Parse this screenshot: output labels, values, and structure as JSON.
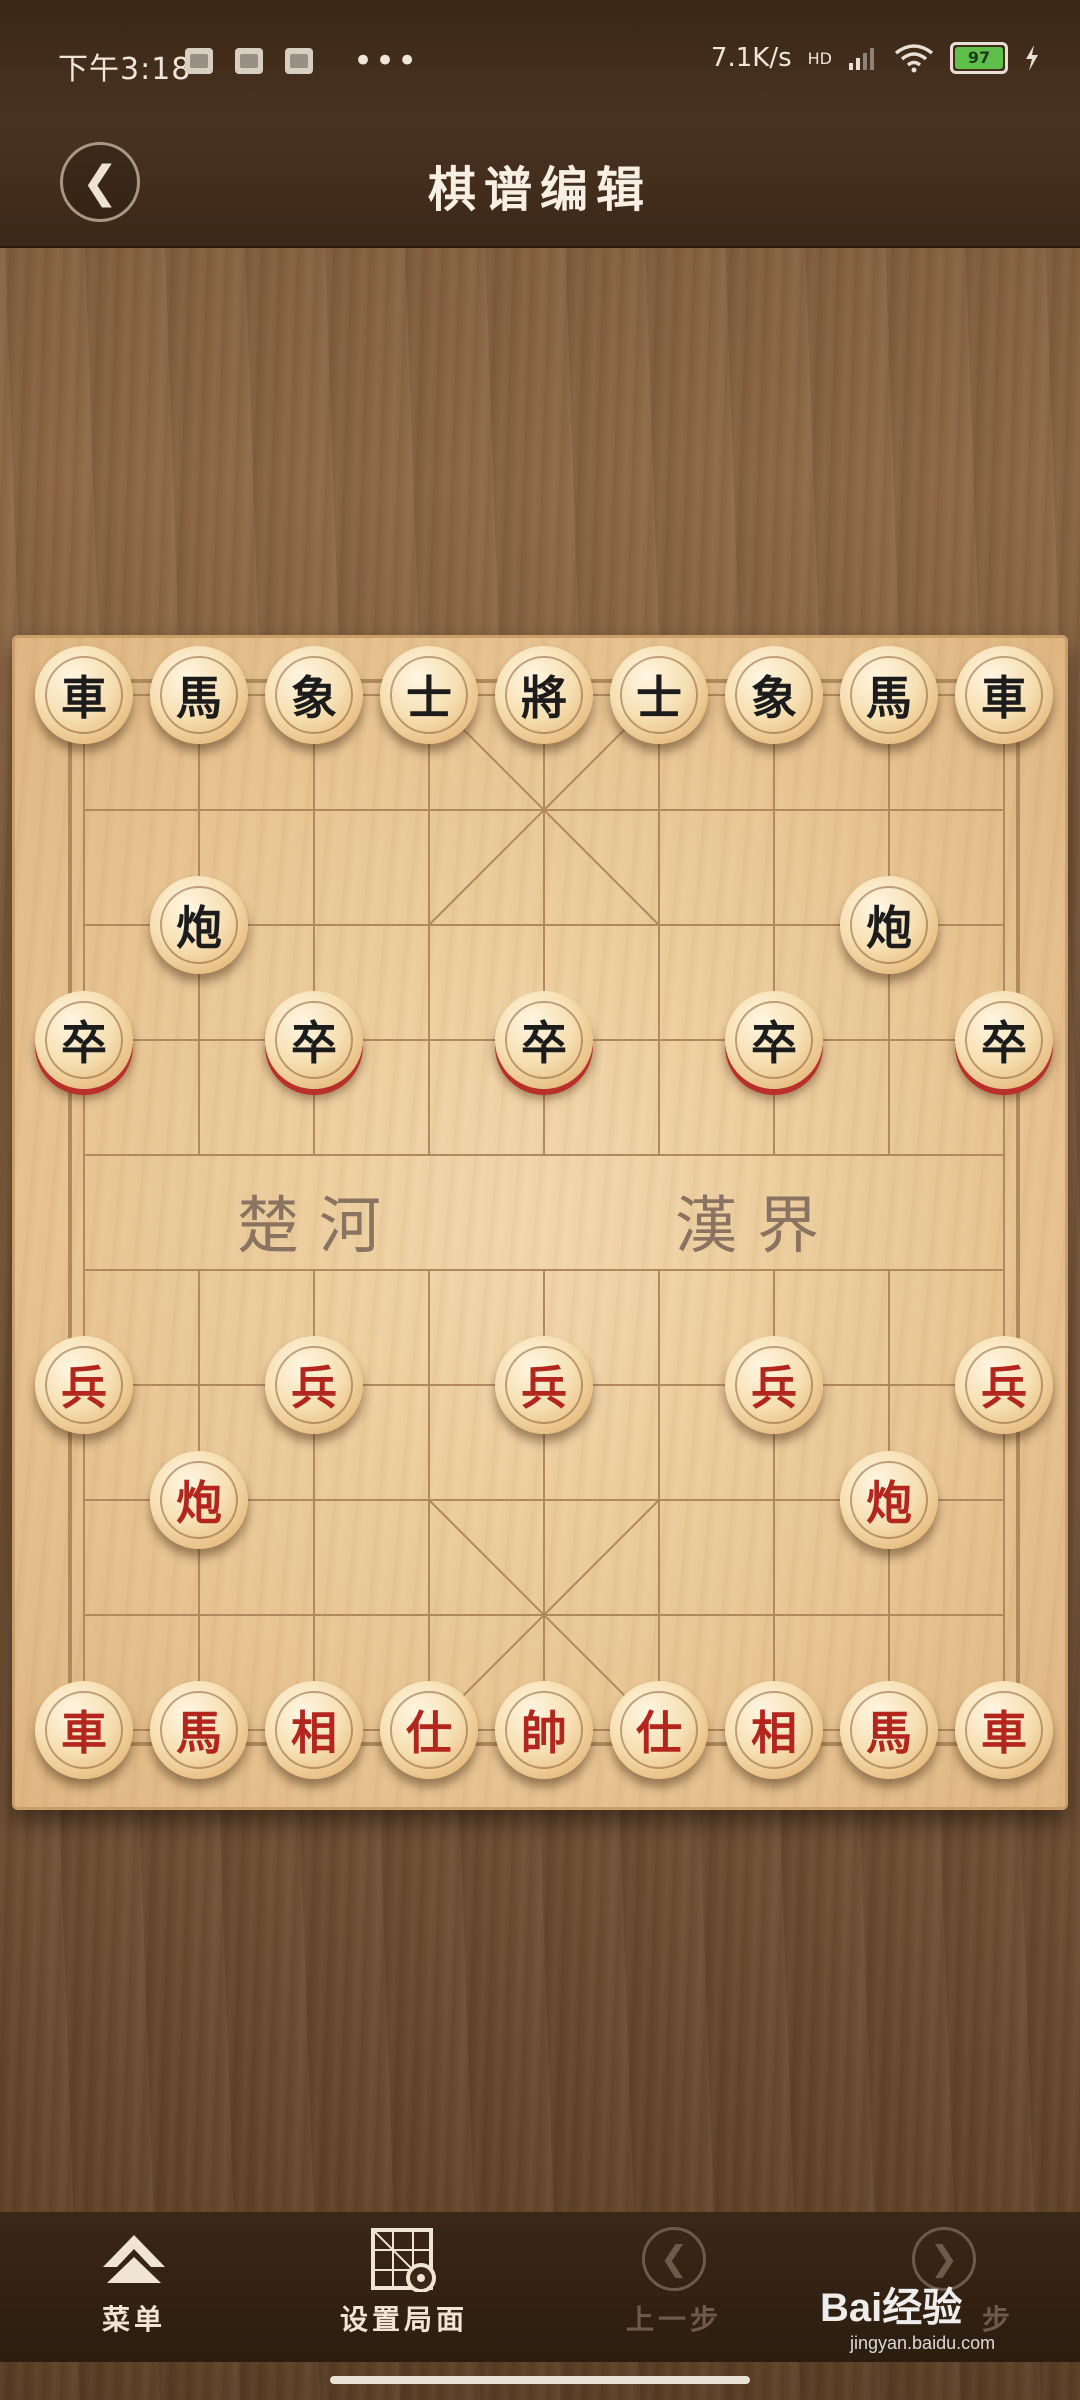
{
  "status_bar": {
    "time": "下午3:18",
    "network_speed": "7.1K/s",
    "network_badge": "HD",
    "battery": "97",
    "more_dots": "•••"
  },
  "header": {
    "title": "棋谱编辑",
    "back_icon": "back-chevron-icon",
    "back_symbol": "❮"
  },
  "board": {
    "river_left": "楚河",
    "river_right": "漢界",
    "pieces": [
      {
        "id": "b-chariot-l",
        "char": "車",
        "side": "black",
        "col": 0,
        "row": 0
      },
      {
        "id": "b-horse-l",
        "char": "馬",
        "side": "black",
        "col": 1,
        "row": 0
      },
      {
        "id": "b-elephant-l",
        "char": "象",
        "side": "black",
        "col": 2,
        "row": 0
      },
      {
        "id": "b-advisor-l",
        "char": "士",
        "side": "black",
        "col": 3,
        "row": 0
      },
      {
        "id": "b-general",
        "char": "將",
        "side": "black",
        "col": 4,
        "row": 0
      },
      {
        "id": "b-advisor-r",
        "char": "士",
        "side": "black",
        "col": 5,
        "row": 0
      },
      {
        "id": "b-elephant-r",
        "char": "象",
        "side": "black",
        "col": 6,
        "row": 0
      },
      {
        "id": "b-horse-r",
        "char": "馬",
        "side": "black",
        "col": 7,
        "row": 0
      },
      {
        "id": "b-chariot-r",
        "char": "車",
        "side": "black",
        "col": 8,
        "row": 0
      },
      {
        "id": "b-cannon-l",
        "char": "炮",
        "side": "black",
        "col": 1,
        "row": 2
      },
      {
        "id": "b-cannon-r",
        "char": "炮",
        "side": "black",
        "col": 7,
        "row": 2
      },
      {
        "id": "b-soldier-1",
        "char": "卒",
        "side": "black",
        "col": 0,
        "row": 3,
        "ring": true
      },
      {
        "id": "b-soldier-2",
        "char": "卒",
        "side": "black",
        "col": 2,
        "row": 3,
        "ring": true
      },
      {
        "id": "b-soldier-3",
        "char": "卒",
        "side": "black",
        "col": 4,
        "row": 3,
        "ring": true
      },
      {
        "id": "b-soldier-4",
        "char": "卒",
        "side": "black",
        "col": 6,
        "row": 3,
        "ring": true
      },
      {
        "id": "b-soldier-5",
        "char": "卒",
        "side": "black",
        "col": 8,
        "row": 3,
        "ring": true
      },
      {
        "id": "r-soldier-1",
        "char": "兵",
        "side": "red",
        "col": 0,
        "row": 6
      },
      {
        "id": "r-soldier-2",
        "char": "兵",
        "side": "red",
        "col": 2,
        "row": 6
      },
      {
        "id": "r-soldier-3",
        "char": "兵",
        "side": "red",
        "col": 4,
        "row": 6
      },
      {
        "id": "r-soldier-4",
        "char": "兵",
        "side": "red",
        "col": 6,
        "row": 6
      },
      {
        "id": "r-soldier-5",
        "char": "兵",
        "side": "red",
        "col": 8,
        "row": 6
      },
      {
        "id": "r-cannon-l",
        "char": "炮",
        "side": "red",
        "col": 1,
        "row": 7
      },
      {
        "id": "r-cannon-r",
        "char": "炮",
        "side": "red",
        "col": 7,
        "row": 7
      },
      {
        "id": "r-chariot-l",
        "char": "車",
        "side": "red",
        "col": 0,
        "row": 9
      },
      {
        "id": "r-horse-l",
        "char": "馬",
        "side": "red",
        "col": 1,
        "row": 9
      },
      {
        "id": "r-elephant-l",
        "char": "相",
        "side": "red",
        "col": 2,
        "row": 9
      },
      {
        "id": "r-advisor-l",
        "char": "仕",
        "side": "red",
        "col": 3,
        "row": 9
      },
      {
        "id": "r-general",
        "char": "帥",
        "side": "red",
        "col": 4,
        "row": 9
      },
      {
        "id": "r-advisor-r",
        "char": "仕",
        "side": "red",
        "col": 5,
        "row": 9
      },
      {
        "id": "r-elephant-r",
        "char": "相",
        "side": "red",
        "col": 6,
        "row": 9
      },
      {
        "id": "r-horse-r",
        "char": "馬",
        "side": "red",
        "col": 7,
        "row": 9
      },
      {
        "id": "r-chariot-r",
        "char": "車",
        "side": "red",
        "col": 8,
        "row": 9
      }
    ]
  },
  "toolbar": {
    "menu_label": "菜单",
    "setup_label": "设置局面",
    "prev_label": "上一步",
    "next_label": "步",
    "prev_symbol": "❮",
    "next_symbol": "❯"
  },
  "watermark": {
    "text": "Bai经验",
    "sub": "jingyan.baidu.com"
  },
  "colors": {
    "red_piece_text": "#b3261e",
    "black_piece_text": "#1c1c1c",
    "board": "#e9c796",
    "bar": "#3a2716"
  }
}
